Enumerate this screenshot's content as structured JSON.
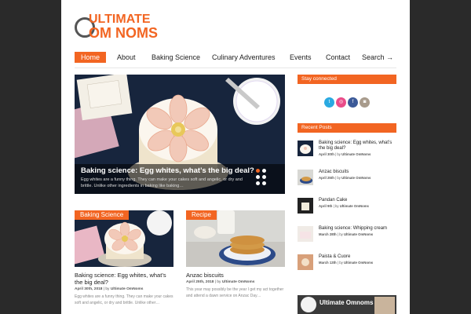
{
  "logo": {
    "line1": "ULTIMATE",
    "line2_a": "OM NOM",
    "line2_b": "S"
  },
  "nav": {
    "items": [
      {
        "label": "Home"
      },
      {
        "label": "About"
      },
      {
        "label": "Baking Science"
      },
      {
        "label": "Culinary Adventures"
      },
      {
        "label": "Events"
      },
      {
        "label": "Contact"
      },
      {
        "label": "Search →"
      }
    ]
  },
  "hero": {
    "title": "Baking science: Egg whites, what’s the big deal?",
    "excerpt": "Egg whites are a funny thing. They can make your cakes soft and angelic, or dry and brittle. Unlike other ingredients in baking like baking…"
  },
  "cards": [
    {
      "tag": "Baking Science",
      "title": "Baking science: Egg whites, what’s the big deal?",
      "date": "April 30th, 2018",
      "by": "by",
      "author": "Ultimate OmNoms",
      "excerpt": "Egg whites are a funny thing. They can make your cakes soft and angelic, or dry and brittle. Unlike other…"
    },
    {
      "tag": "Recipe",
      "title": "Anzac biscuits",
      "date": "April 25th, 2018",
      "by": "by",
      "author": "Ultimate OmNoms",
      "excerpt": "This year may possibly be the year I get my act together and attend a dawn service on Anzac Day…"
    }
  ],
  "sidebar": {
    "stay_connected": "Stay connected",
    "social": [
      {
        "icon": "twitter-icon",
        "glyph": "t",
        "color": "#29a9e1"
      },
      {
        "icon": "dribbble-icon",
        "glyph": "◎",
        "color": "#ea4c89"
      },
      {
        "icon": "facebook-icon",
        "glyph": "f",
        "color": "#3b5998"
      },
      {
        "icon": "instagram-icon",
        "glyph": "◙",
        "color": "#a89b8c"
      }
    ],
    "recent_posts": "Recent Posts",
    "posts": [
      {
        "title": "Baking science: Egg whites, what’s the big deal?",
        "date": "April 30th",
        "by": "by",
        "author": "Ultimate OmNoms"
      },
      {
        "title": "Anzac biscuits",
        "date": "April 25th",
        "by": "by",
        "author": "Ultimate OmNoms"
      },
      {
        "title": "Pandan Cake",
        "date": "April 9th",
        "by": "by",
        "author": "Ultimate OmNoms"
      },
      {
        "title": "Baking science: Whipping cream",
        "date": "March 28th",
        "by": "by",
        "author": "Ultimate OmNoms"
      },
      {
        "title": "Paista & Cuore",
        "date": "March 13th",
        "by": "by",
        "author": "Ultimate OmNoms"
      }
    ],
    "promo": "Ultimate Omnoms"
  },
  "colors": {
    "accent": "#f26522",
    "background": "#2a2a2a",
    "page": "#ffffff"
  }
}
